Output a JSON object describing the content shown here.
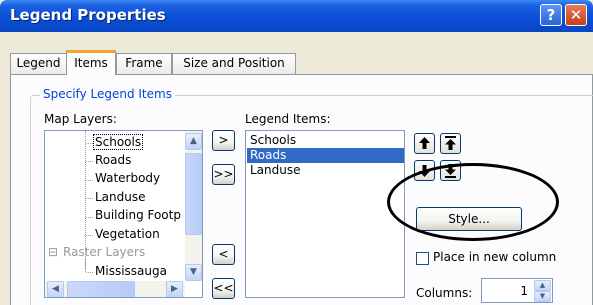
{
  "window": {
    "title": "Legend Properties",
    "help_glyph": "?",
    "close_glyph": "✕"
  },
  "tabs": [
    {
      "label": "Legend",
      "active": false
    },
    {
      "label": "Items",
      "active": true
    },
    {
      "label": "Frame",
      "active": false
    },
    {
      "label": "Size and Position",
      "active": false
    }
  ],
  "group": {
    "title": "Specify Legend Items"
  },
  "map_layers": {
    "label": "Map Layers:",
    "items": [
      "Schools",
      "Roads",
      "Waterbody",
      "Landuse",
      "Building Footp",
      "Vegetation",
      "Raster Layers",
      "Mississauga"
    ],
    "selected": "Schools",
    "group_node": {
      "label": "Raster Layers",
      "expander": "⊟"
    }
  },
  "transfer_buttons": {
    "add": ">",
    "add_all": ">>",
    "remove": "<",
    "remove_all": "<<"
  },
  "legend_items": {
    "label": "Legend Items:",
    "items": [
      "Schools",
      "Roads",
      "Landuse"
    ],
    "selected": "Roads"
  },
  "order_buttons": {
    "icons": [
      "move-up-icon",
      "move-top-icon",
      "move-down-icon",
      "move-bottom-icon"
    ]
  },
  "style_button": {
    "label": "Style..."
  },
  "place_in_new_column": {
    "label": "Place in new column",
    "checked": false
  },
  "columns": {
    "label": "Columns:",
    "value": "1"
  },
  "colors": {
    "title_bar": "#0a4fd6",
    "selection": "#316ac5",
    "group_title": "#0046d5",
    "active_tab": "#f5a52b"
  }
}
